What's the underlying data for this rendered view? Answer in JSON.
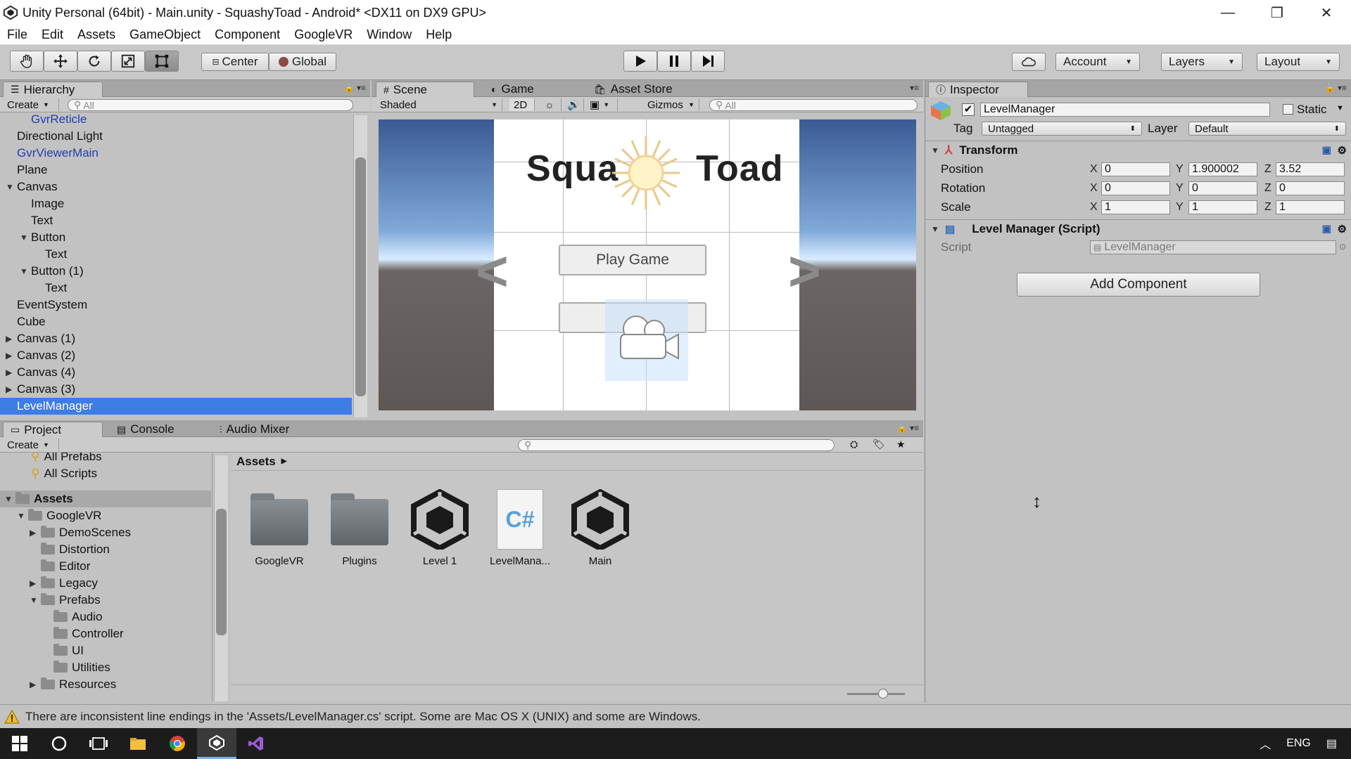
{
  "window": {
    "title": "Unity Personal (64bit) - Main.unity - SquashyToad - Android* <DX11 on DX9 GPU>",
    "minimize": "—",
    "maximize": "❐",
    "close": "✕"
  },
  "menu": [
    "File",
    "Edit",
    "Assets",
    "GameObject",
    "Component",
    "GoogleVR",
    "Window",
    "Help"
  ],
  "toolbar": {
    "center": "Center",
    "global": "Global",
    "account": "Account",
    "layers": "Layers",
    "layout": "Layout"
  },
  "hierarchy": {
    "tab": "Hierarchy",
    "create": "Create",
    "search_placeholder": "All",
    "items": [
      {
        "label": "GvrReticle",
        "indent": 2,
        "expander": "",
        "color": "blue"
      },
      {
        "label": "Directional Light",
        "indent": 1,
        "expander": "",
        "color": "normal"
      },
      {
        "label": "GvrViewerMain",
        "indent": 1,
        "expander": "",
        "color": "blue"
      },
      {
        "label": "Plane",
        "indent": 1,
        "expander": "",
        "color": "normal"
      },
      {
        "label": "Canvas",
        "indent": 1,
        "expander": "▼",
        "color": "normal"
      },
      {
        "label": "Image",
        "indent": 2,
        "expander": "",
        "color": "normal"
      },
      {
        "label": "Text",
        "indent": 2,
        "expander": "",
        "color": "normal"
      },
      {
        "label": "Button",
        "indent": 2,
        "expander": "▼",
        "color": "normal"
      },
      {
        "label": "Text",
        "indent": 3,
        "expander": "",
        "color": "normal"
      },
      {
        "label": "Button (1)",
        "indent": 2,
        "expander": "▼",
        "color": "normal"
      },
      {
        "label": "Text",
        "indent": 3,
        "expander": "",
        "color": "normal"
      },
      {
        "label": "EventSystem",
        "indent": 1,
        "expander": "",
        "color": "normal"
      },
      {
        "label": "Cube",
        "indent": 1,
        "expander": "",
        "color": "normal"
      },
      {
        "label": "Canvas (1)",
        "indent": 1,
        "expander": "▶",
        "color": "normal"
      },
      {
        "label": "Canvas (2)",
        "indent": 1,
        "expander": "▶",
        "color": "normal"
      },
      {
        "label": "Canvas (4)",
        "indent": 1,
        "expander": "▶",
        "color": "normal"
      },
      {
        "label": "Canvas (3)",
        "indent": 1,
        "expander": "▶",
        "color": "normal"
      },
      {
        "label": "LevelManager",
        "indent": 1,
        "expander": "",
        "color": "selected"
      }
    ]
  },
  "scene": {
    "tabs": [
      "Scene",
      "Game",
      "Asset Store"
    ],
    "shading": "Shaded",
    "mode_2d": "2D",
    "gizmos": "Gizmos",
    "search_placeholder": "All",
    "game_title_left": "Squa",
    "game_title_right": "Toad",
    "play_button": "Play Game",
    "nav_left": "<",
    "nav_right": ">"
  },
  "inspector": {
    "tab": "Inspector",
    "object_name": "LevelManager",
    "static_label": "Static",
    "tag_label": "Tag",
    "tag_value": "Untagged",
    "layer_label": "Layer",
    "layer_value": "Default",
    "transform": {
      "title": "Transform",
      "position_label": "Position",
      "rotation_label": "Rotation",
      "scale_label": "Scale",
      "position": {
        "x": "0",
        "y": "1.900002",
        "z": "3.52"
      },
      "rotation": {
        "x": "0",
        "y": "0",
        "z": "0"
      },
      "scale": {
        "x": "1",
        "y": "1",
        "z": "1"
      }
    },
    "script_component": {
      "title": "Level Manager (Script)",
      "script_label": "Script",
      "script_value": "LevelManager"
    },
    "add_component": "Add Component",
    "axis_x": "X",
    "axis_y": "Y",
    "axis_z": "Z"
  },
  "project": {
    "tabs": [
      "Project",
      "Console",
      "Audio Mixer"
    ],
    "create": "Create",
    "breadcrumb": "Assets",
    "favorites": [
      "All Prefabs",
      "All Scripts"
    ],
    "tree": [
      {
        "label": "Assets",
        "indent": 0,
        "expander": "▼",
        "bold": true
      },
      {
        "label": "GoogleVR",
        "indent": 1,
        "expander": "▼",
        "bold": false
      },
      {
        "label": "DemoScenes",
        "indent": 2,
        "expander": "▶",
        "bold": false
      },
      {
        "label": "Distortion",
        "indent": 2,
        "expander": "",
        "bold": false
      },
      {
        "label": "Editor",
        "indent": 2,
        "expander": "",
        "bold": false
      },
      {
        "label": "Legacy",
        "indent": 2,
        "expander": "▶",
        "bold": false
      },
      {
        "label": "Prefabs",
        "indent": 2,
        "expander": "▼",
        "bold": false
      },
      {
        "label": "Audio",
        "indent": 3,
        "expander": "",
        "bold": false
      },
      {
        "label": "Controller",
        "indent": 3,
        "expander": "",
        "bold": false
      },
      {
        "label": "UI",
        "indent": 3,
        "expander": "",
        "bold": false
      },
      {
        "label": "Utilities",
        "indent": 3,
        "expander": "",
        "bold": false
      },
      {
        "label": "Resources",
        "indent": 2,
        "expander": "▶",
        "bold": false
      }
    ],
    "assets": [
      {
        "label": "GoogleVR",
        "kind": "folder"
      },
      {
        "label": "Plugins",
        "kind": "folder"
      },
      {
        "label": "Level 1",
        "kind": "unity"
      },
      {
        "label": "LevelMana...",
        "kind": "script"
      },
      {
        "label": "Main",
        "kind": "unity"
      }
    ],
    "csharp_glyph": "C#"
  },
  "status": {
    "message": "There are inconsistent line endings in the 'Assets/LevelManager.cs' script. Some are Mac OS X (UNIX) and some are Windows."
  },
  "taskbar": {
    "language": "ENG"
  },
  "colors": {
    "selection": "#3e7ce6",
    "prefab_text": "#1f3fb0",
    "panel_bg": "#c2c2c2"
  }
}
